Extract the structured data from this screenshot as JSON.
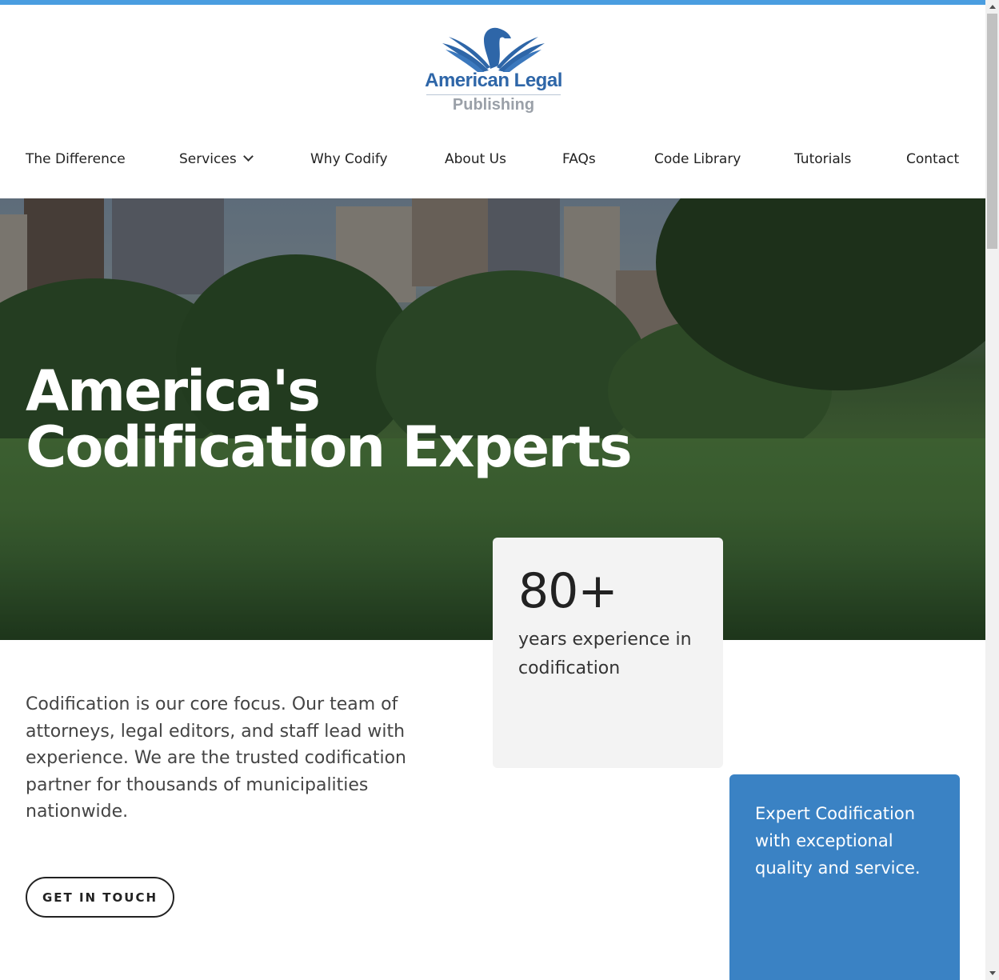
{
  "brand": {
    "name_line1": "American Legal",
    "name_line2": "Publishing",
    "logo_icon": "eagle-icon",
    "accent_color": "#4a9de0",
    "logo_color": "#2e66a8"
  },
  "nav": {
    "items": [
      {
        "label": "The Difference"
      },
      {
        "label": "Services",
        "has_dropdown": true
      },
      {
        "label": "Why Codify"
      },
      {
        "label": "About Us"
      },
      {
        "label": "FAQs"
      },
      {
        "label": "Code Library"
      },
      {
        "label": "Tutorials"
      },
      {
        "label": "Contact"
      }
    ]
  },
  "hero": {
    "title_line1": "America's",
    "title_line2": "Codification Experts"
  },
  "stat": {
    "number": "80+",
    "text": "years experience in codification"
  },
  "intro": {
    "text": "Codification is our core focus. Our team of attorneys, legal editors, and staff lead with experience. We are the trusted codification partner for thousands of municipalities nationwide."
  },
  "cta": {
    "label": "GET IN TOUCH"
  },
  "highlight": {
    "text": "Expert Codification with exceptional quality and service.",
    "color": "#3a82c4"
  }
}
